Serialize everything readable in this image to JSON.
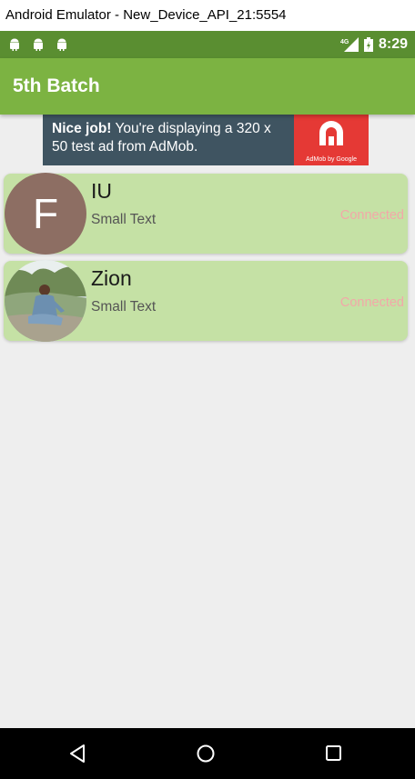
{
  "window": {
    "title": "Android Emulator - New_Device_API_21:5554"
  },
  "status_bar": {
    "notification_icons": [
      "android-icon",
      "android-icon",
      "android-icon"
    ],
    "network": "4G",
    "time": "8:29",
    "background": "#5a8e31"
  },
  "app_bar": {
    "title": "5th Batch",
    "background": "#7cb342"
  },
  "ad": {
    "bold_text": "Nice job!",
    "text": " You're displaying a 320 x 50 test ad from AdMob.",
    "logo_caption": "AdMob by Google",
    "logo_color": "#e53935"
  },
  "contacts": [
    {
      "name": "IU",
      "subtitle": "Small Text",
      "status": "Connected",
      "avatar_type": "letter",
      "avatar_letter": "F"
    },
    {
      "name": "Zion",
      "subtitle": "Small Text",
      "status": "Connected",
      "avatar_type": "photo"
    }
  ],
  "colors": {
    "card_background": "#c5e1a5",
    "status_connected": "#f2a8a8",
    "screen_background": "#eeeeee"
  },
  "nav_bar": {
    "buttons": [
      "back-icon",
      "home-icon",
      "recents-icon"
    ]
  }
}
